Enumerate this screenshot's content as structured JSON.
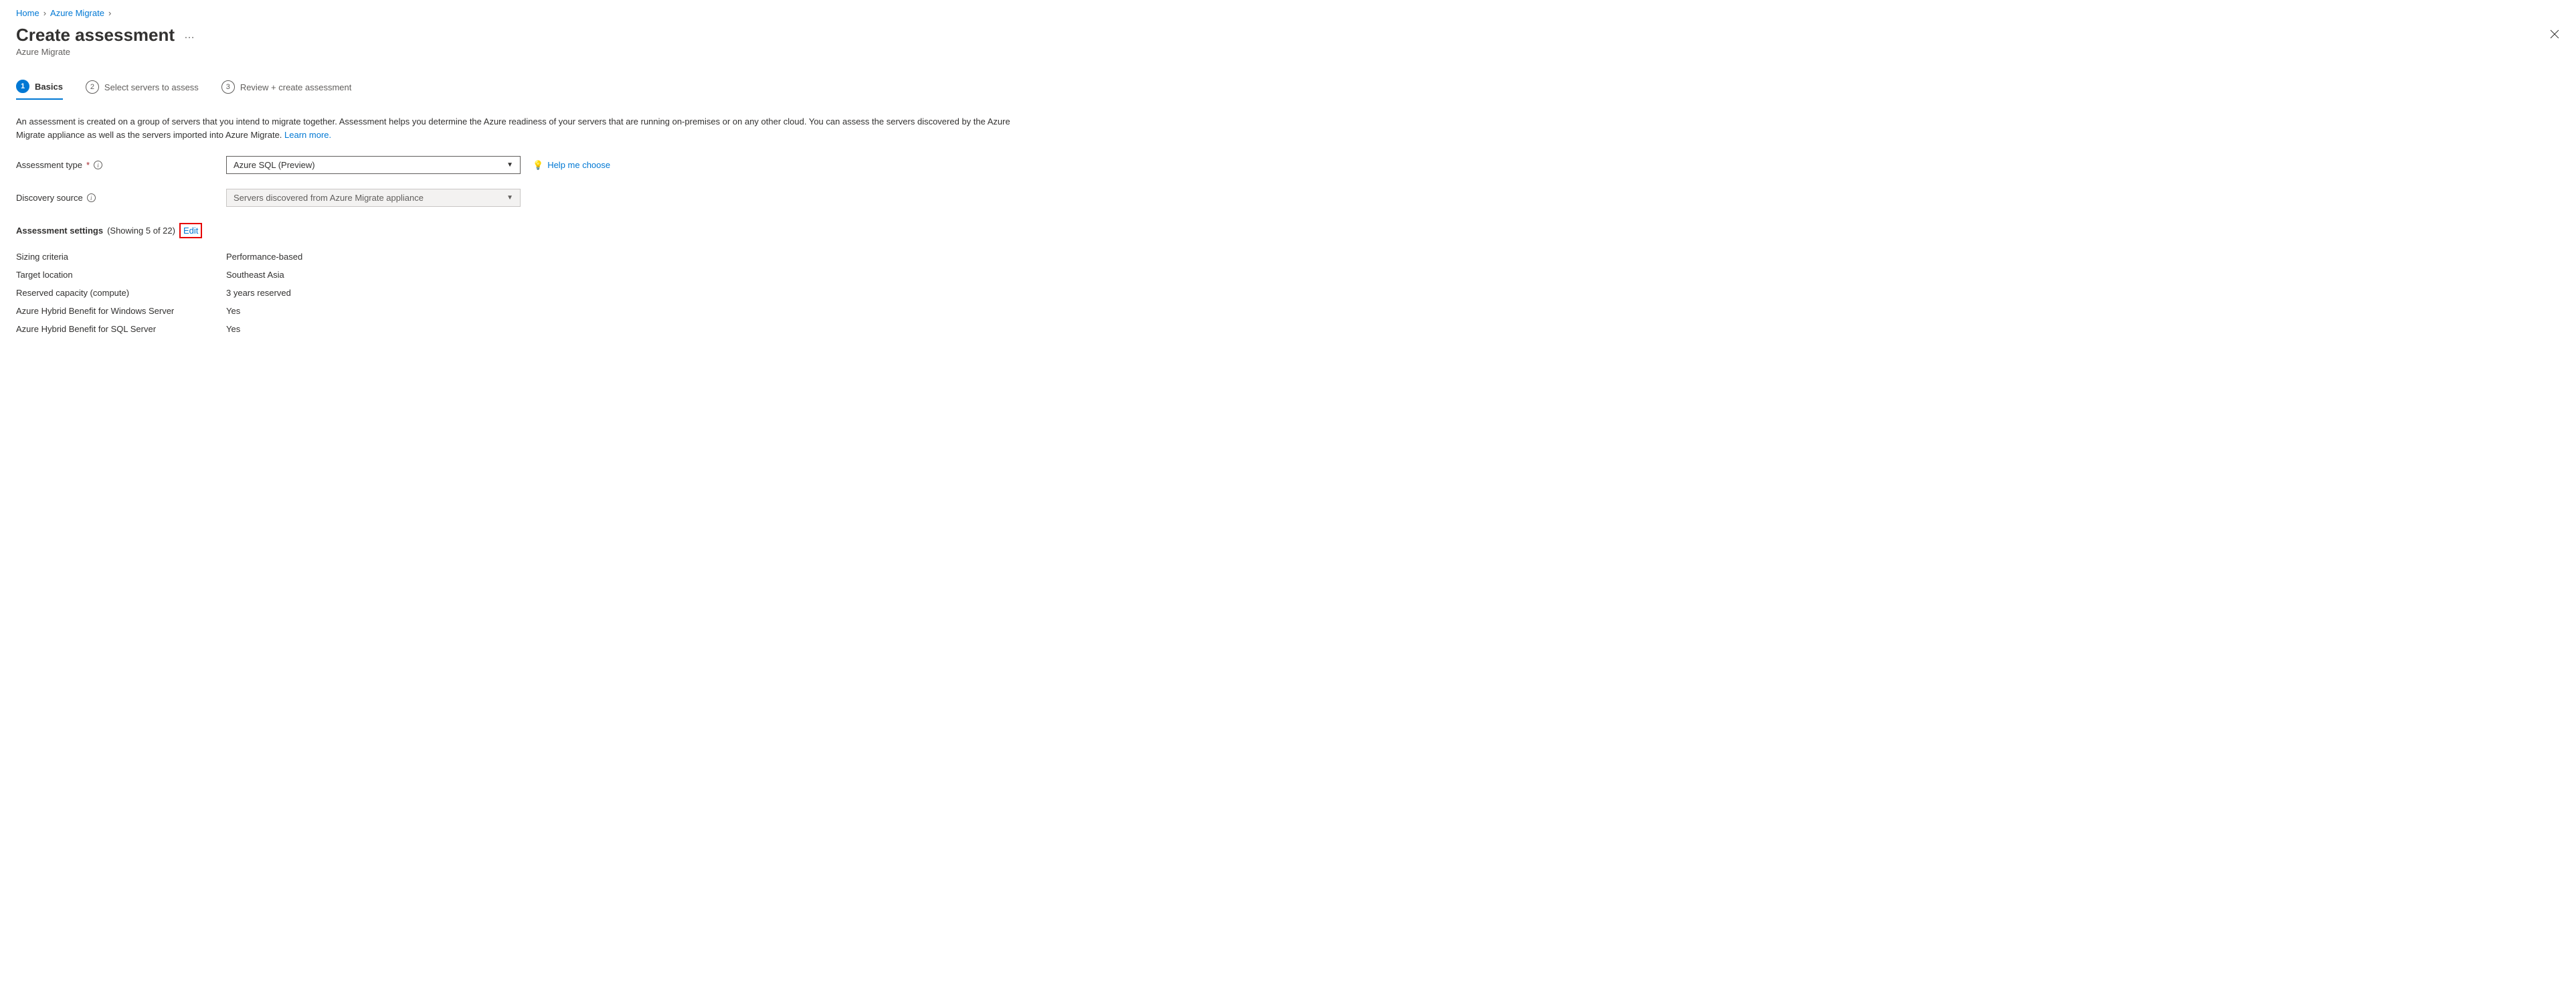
{
  "breadcrumb": {
    "home": "Home",
    "azureMigrate": "Azure Migrate"
  },
  "page": {
    "title": "Create assessment",
    "subtitle": "Azure Migrate"
  },
  "tabs": {
    "basics": "Basics",
    "selectServers": "Select servers to assess",
    "review": "Review + create assessment",
    "num1": "1",
    "num2": "2",
    "num3": "3"
  },
  "description": {
    "text": "An assessment is created on a group of servers that you intend to migrate together. Assessment helps you determine the Azure readiness of your servers that are running on-premises or on any other cloud. You can assess the servers discovered by the Azure Migrate appliance as well as the servers imported into Azure Migrate. ",
    "learnMore": "Learn more."
  },
  "form": {
    "assessmentTypeLabel": "Assessment type",
    "assessmentTypeValue": "Azure SQL (Preview)",
    "helpMeChoose": "Help me choose",
    "discoverySourceLabel": "Discovery source",
    "discoverySourceValue": "Servers discovered from Azure Migrate appliance"
  },
  "settings": {
    "heading": "Assessment settings",
    "count": "(Showing 5 of 22)",
    "edit": "Edit",
    "rows": [
      {
        "k": "Sizing criteria",
        "v": "Performance-based"
      },
      {
        "k": "Target location",
        "v": "Southeast Asia"
      },
      {
        "k": "Reserved capacity (compute)",
        "v": "3 years reserved"
      },
      {
        "k": "Azure Hybrid Benefit for Windows Server",
        "v": "Yes"
      },
      {
        "k": "Azure Hybrid Benefit for SQL Server",
        "v": "Yes"
      }
    ]
  }
}
